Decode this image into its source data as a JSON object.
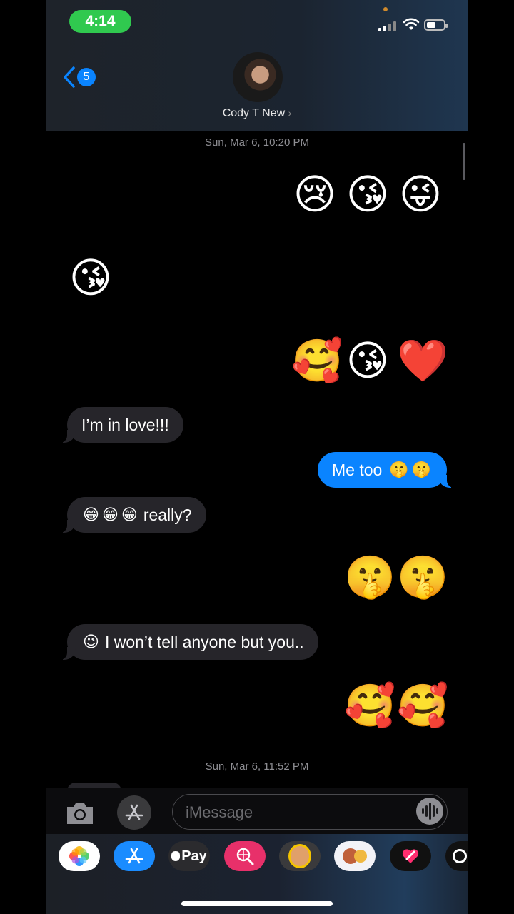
{
  "status_bar": {
    "time": "4:14"
  },
  "header": {
    "back_count": "5",
    "contact_name": "Cody T New",
    "contact_chevron": "›"
  },
  "timestamps": {
    "first": "Sun, Mar 6, 10:20 PM",
    "second": "Sun, Mar 6, 11:52 PM"
  },
  "messages": [
    {
      "from": "me",
      "emojis": [
        "😢",
        "😘",
        "😜"
      ]
    },
    {
      "from": "them",
      "emojis": [
        "😘"
      ]
    },
    {
      "from": "me",
      "emojis": [
        "🥰",
        "😘",
        "❤️"
      ]
    },
    {
      "from": "them",
      "text": "I’m in love!!!"
    },
    {
      "from": "me",
      "text": "Me too",
      "emojis": [
        "🤫",
        "🤫"
      ]
    },
    {
      "from": "them",
      "emojis": [
        "😁",
        "😁",
        "😁"
      ],
      "text": "really?"
    },
    {
      "from": "me",
      "emojis": [
        "🤫",
        "🤫"
      ]
    },
    {
      "from": "them",
      "emojis": [
        "😉"
      ],
      "text": "I won’t tell anyone but you.."
    },
    {
      "from": "me",
      "emojis": [
        "🥰",
        "🥰"
      ]
    }
  ],
  "input": {
    "placeholder": "iMessage"
  },
  "app_drawer": {
    "apps": [
      {
        "name": "photos-app-icon"
      },
      {
        "name": "app-store-icon"
      },
      {
        "name": "apple-pay-icon",
        "label": "Pay"
      },
      {
        "name": "image-search-icon"
      },
      {
        "name": "memoji-icon"
      },
      {
        "name": "animoji-icon"
      },
      {
        "name": "digital-touch-icon"
      }
    ]
  },
  "colors": {
    "sent_bubble": "#0a84ff",
    "received_bubble": "#26252a",
    "status_pill": "#30c94f"
  }
}
